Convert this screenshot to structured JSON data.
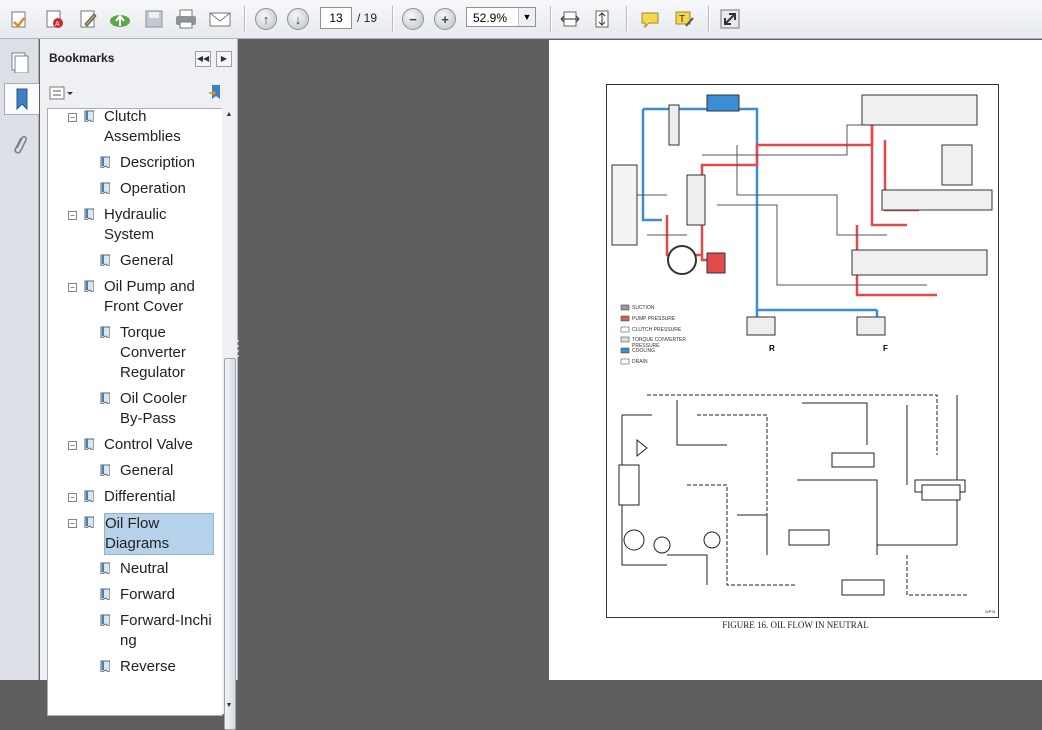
{
  "toolbar": {
    "page_current": "13",
    "page_total": "/ 19",
    "zoom_value": "52.9%"
  },
  "bookmarks": {
    "title": "Bookmarks",
    "items": [
      {
        "label": "Clutch Assemblies",
        "lines": [
          "Clutch",
          "Assemblies"
        ],
        "level": 1
      },
      {
        "label": "Description",
        "lines": [
          "Description"
        ],
        "level": 2
      },
      {
        "label": "Operation",
        "lines": [
          "Operation"
        ],
        "level": 2
      },
      {
        "label": "Hydraulic System",
        "lines": [
          "Hydraulic",
          "System"
        ],
        "level": 1
      },
      {
        "label": "General",
        "lines": [
          "General"
        ],
        "level": 2
      },
      {
        "label": "Oil Pump and Front Cover",
        "lines": [
          "Oil Pump and",
          "Front Cover"
        ],
        "level": 1
      },
      {
        "label": "Torque Converter Regulator",
        "lines": [
          "Torque",
          "Converter",
          "Regulator"
        ],
        "level": 2
      },
      {
        "label": "Oil Cooler By-Pass",
        "lines": [
          "Oil Cooler",
          "By-Pass"
        ],
        "level": 2
      },
      {
        "label": "Control Valve",
        "lines": [
          "Control Valve"
        ],
        "level": 1
      },
      {
        "label": "General",
        "lines": [
          "General"
        ],
        "level": 2
      },
      {
        "label": "Differential",
        "lines": [
          "Differential"
        ],
        "level": 1
      },
      {
        "label": "Oil Flow Diagrams",
        "lines": [
          "Oil Flow",
          "Diagrams"
        ],
        "level": 1,
        "selected": true
      },
      {
        "label": "Neutral",
        "lines": [
          "Neutral"
        ],
        "level": 2
      },
      {
        "label": "Forward",
        "lines": [
          "Forward"
        ],
        "level": 2
      },
      {
        "label": "Forward-Inching",
        "lines": [
          "Forward-Inchi",
          "ng"
        ],
        "level": 2
      },
      {
        "label": "Reverse",
        "lines": [
          "Reverse"
        ],
        "level": 2
      }
    ]
  },
  "document": {
    "caption": "FIGURE 16. OIL FLOW IN NEUTRAL",
    "legend": [
      "SUCTION",
      "PUMP PRESSURE",
      "CLUTCH PRESSURE",
      "TORQUE CONVERTER PRESSURE",
      "COOLING",
      "DRAIN"
    ],
    "legend_colors": [
      "#9a9a9a",
      "#e05a5a",
      "#ffffff",
      "#dcdcdc",
      "#3d8fd0",
      "#ffffff"
    ],
    "labels": {
      "reverse": "R",
      "forward": "F"
    },
    "tiny_code": "WP91"
  },
  "colors": {
    "pump_pressure": "#e04a4a",
    "cooling": "#3a8ed6",
    "selection": "#b5d2ea"
  }
}
